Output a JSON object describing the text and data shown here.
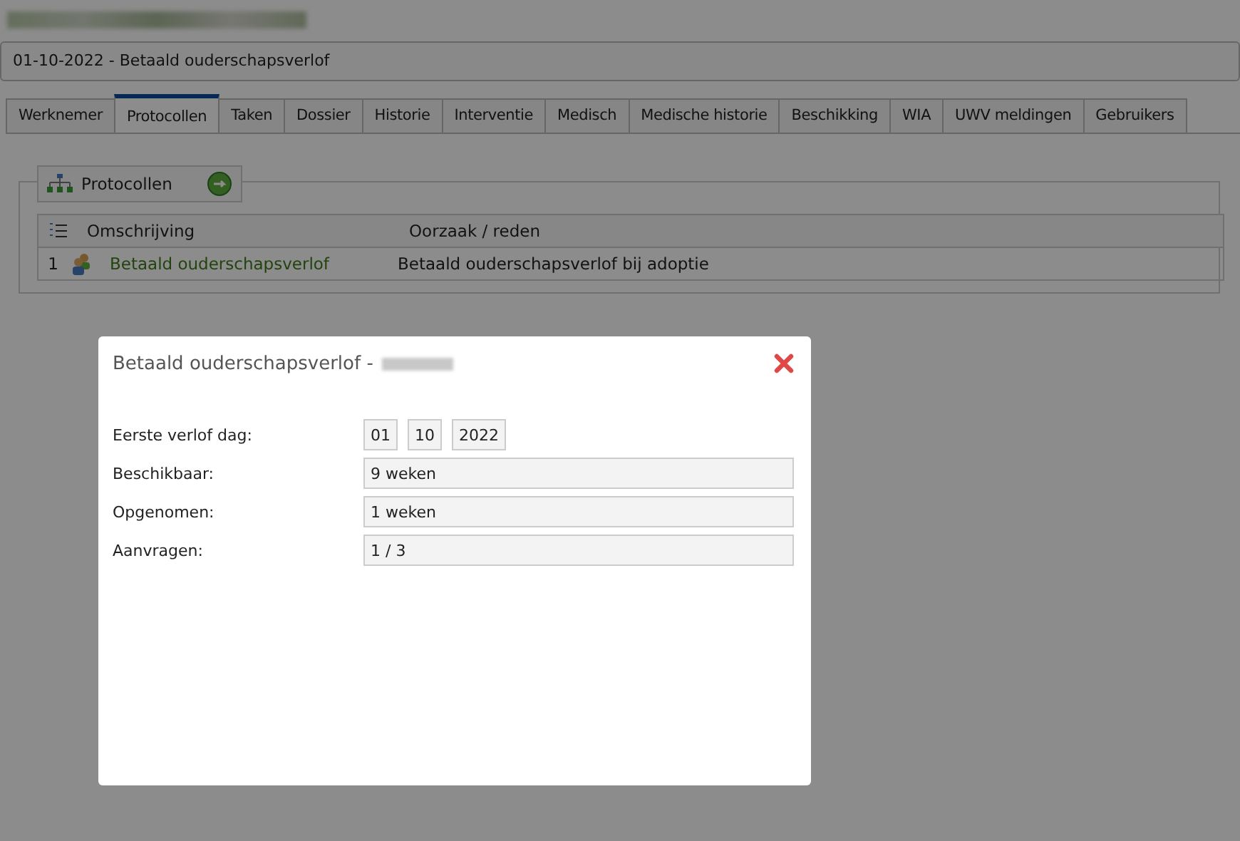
{
  "record_title": "01-10-2022 - Betaald ouderschapsverlof",
  "tabs": [
    {
      "label": "Werknemer",
      "selected": false
    },
    {
      "label": "Protocollen",
      "selected": true
    },
    {
      "label": "Taken",
      "selected": false
    },
    {
      "label": "Dossier",
      "selected": false
    },
    {
      "label": "Historie",
      "selected": false
    },
    {
      "label": "Interventie",
      "selected": false
    },
    {
      "label": "Medisch",
      "selected": false
    },
    {
      "label": "Medische historie",
      "selected": false
    },
    {
      "label": "Beschikking",
      "selected": false
    },
    {
      "label": "WIA",
      "selected": false
    },
    {
      "label": "UWV meldingen",
      "selected": false
    },
    {
      "label": "Gebruikers",
      "selected": false
    }
  ],
  "panel": {
    "legend": "Protocollen",
    "table": {
      "columns": [
        "Omschrijving",
        "Oorzaak / reden"
      ],
      "rows": [
        {
          "number": "1",
          "description": "Betaald ouderschapsverlof",
          "reason": "Betaald ouderschapsverlof bij adoptie"
        }
      ]
    }
  },
  "dialog": {
    "title": "Betaald ouderschapsverlof -",
    "fields": [
      {
        "kind": "date",
        "label": "Eerste verlof dag:",
        "parts": [
          "01",
          "10",
          "2022"
        ]
      },
      {
        "kind": "text",
        "label": "Beschikbaar:",
        "value": "9 weken"
      },
      {
        "kind": "text",
        "label": "Opgenomen:",
        "value": "1 weken"
      },
      {
        "kind": "text",
        "label": "Aanvragen:",
        "value": "1 / 3"
      }
    ]
  }
}
